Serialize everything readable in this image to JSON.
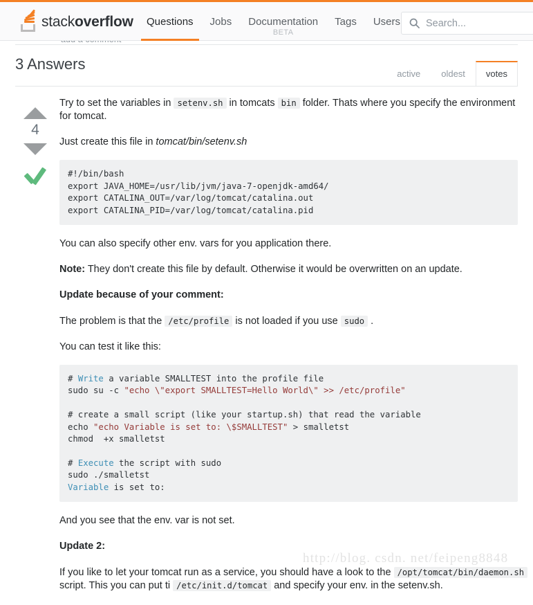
{
  "header": {
    "logo_text_light": "stack",
    "logo_text_bold": "overflow",
    "nav": [
      {
        "label": "Questions",
        "active": true,
        "beta": ""
      },
      {
        "label": "Jobs",
        "active": false,
        "beta": ""
      },
      {
        "label": "Documentation",
        "active": false,
        "beta": "BETA"
      },
      {
        "label": "Tags",
        "active": false,
        "beta": ""
      },
      {
        "label": "Users",
        "active": false,
        "beta": ""
      }
    ],
    "search": {
      "placeholder": "Search...",
      "value": ""
    },
    "accent_color": "#f48024"
  },
  "background_text": {
    "add_comment": "add a comment"
  },
  "answers": {
    "title": "3 Answers",
    "sort_tabs": [
      {
        "label": "active",
        "selected": false
      },
      {
        "label": "oldest",
        "selected": false
      },
      {
        "label": "votes",
        "selected": true
      }
    ]
  },
  "answer": {
    "vote_count": "4",
    "accepted": true,
    "p1": {
      "a": "Try to set the variables in ",
      "code1": "setenv.sh",
      "b": " in tomcats ",
      "code2": "bin",
      "c": " folder. Thats where you specify the environment for tomcat."
    },
    "p2": {
      "a": "Just create this file in ",
      "em": "tomcat/bin/setenv.sh"
    },
    "code_block_1": "#!/bin/bash\nexport JAVA_HOME=/usr/lib/jvm/java-7-openjdk-amd64/\nexport CATALINA_OUT=/var/log/tomcat/catalina.out\nexport CATALINA_PID=/var/log/tomcat/catalina.pid",
    "p3": "You can also specify other env. vars for you application there.",
    "p4": {
      "strong": "Note:",
      "rest": " They don't create this file by default. Otherwise it would be overwritten on an update."
    },
    "h_update1": "Update because of your comment:",
    "p5": {
      "a": "The problem is that the ",
      "code1": "/etc/profile",
      "b": " is not loaded if you use ",
      "code2": "sudo",
      "c": " ."
    },
    "p6": "You can test it like this:",
    "code_block_2_lines": [
      {
        "parts": [
          {
            "t": "# ",
            "c": ""
          },
          {
            "t": "Write",
            "c": "tok-comment-kw"
          },
          {
            "t": " a variable SMALLTEST into the profile file",
            "c": ""
          }
        ]
      },
      {
        "parts": [
          {
            "t": "sudo su -c ",
            "c": ""
          },
          {
            "t": "\"echo \\\"export SMALLTEST=Hello World\\\" >> /etc/profile\"",
            "c": "tok-string"
          }
        ]
      },
      {
        "parts": [
          {
            "t": "",
            "c": ""
          }
        ]
      },
      {
        "parts": [
          {
            "t": "# create a small script (like your startup.sh) that read the variable",
            "c": ""
          }
        ]
      },
      {
        "parts": [
          {
            "t": "echo ",
            "c": ""
          },
          {
            "t": "\"echo Variable is set to: \\$SMALLTEST\"",
            "c": "tok-string"
          },
          {
            "t": " > smalletst",
            "c": ""
          }
        ]
      },
      {
        "parts": [
          {
            "t": "chmod  +x smalletst",
            "c": ""
          }
        ]
      },
      {
        "parts": [
          {
            "t": "",
            "c": ""
          }
        ]
      },
      {
        "parts": [
          {
            "t": "# ",
            "c": ""
          },
          {
            "t": "Execute",
            "c": "tok-comment-kw"
          },
          {
            "t": " the script with sudo",
            "c": ""
          }
        ]
      },
      {
        "parts": [
          {
            "t": "sudo ./smalletst",
            "c": ""
          }
        ]
      },
      {
        "parts": [
          {
            "t": "Variable",
            "c": "tok-var"
          },
          {
            "t": " is set to:",
            "c": ""
          }
        ]
      }
    ],
    "p7": "And you see that the env. var is not set.",
    "h_update2": "Update 2:",
    "p8": {
      "a": "If you like to let your tomcat run as a service, you should have a look to the ",
      "code1": "/opt/tomcat/bin/daemon.sh",
      "b": " script. This you can put ti ",
      "code2": "/etc/init.d/tomcat",
      "c": " and specify your env. in the setenv.sh."
    }
  },
  "watermark": "http://blog. csdn. net/feipeng8848"
}
